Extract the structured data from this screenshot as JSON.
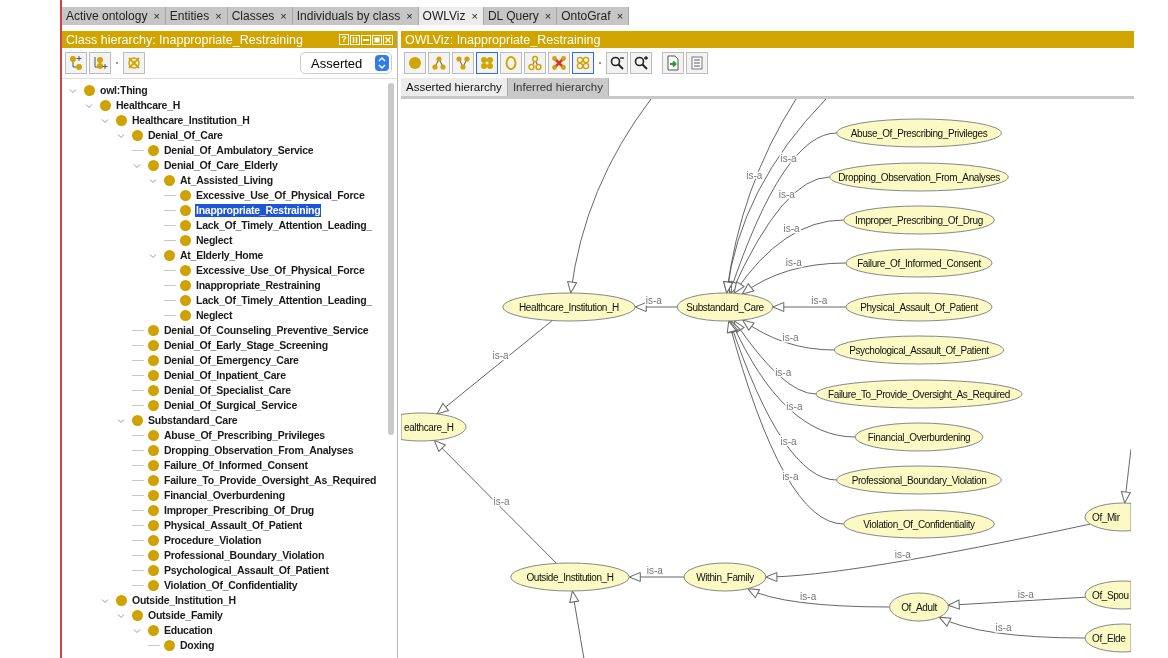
{
  "tabs": [
    {
      "label": "Active ontology",
      "close": "×",
      "selected": false
    },
    {
      "label": "Entities",
      "close": "×",
      "selected": false
    },
    {
      "label": "Classes",
      "close": "×",
      "selected": false
    },
    {
      "label": "Individuals by class",
      "close": "×",
      "selected": false
    },
    {
      "label": "OWLViz",
      "close": "×",
      "selected": true
    },
    {
      "label": "DL Query",
      "close": "×",
      "selected": false
    },
    {
      "label": "OntoGraf",
      "close": "×",
      "selected": false
    }
  ],
  "class_hierarchy": {
    "title": "Class hierarchy: Inappropriate_Restraining",
    "help": "?",
    "mode": "Asserted",
    "tree": [
      {
        "label": "owl:Thing",
        "selected": false,
        "expanded": true,
        "children": [
          {
            "label": "Healthcare_H",
            "selected": false,
            "expanded": true,
            "children": [
              {
                "label": "Healthcare_Institution_H",
                "selected": false,
                "expanded": true,
                "children": [
                  {
                    "label": "Denial_Of_Care",
                    "selected": false,
                    "expanded": true,
                    "children": [
                      {
                        "label": "Denial_Of_Ambulatory_Service",
                        "selected": false
                      },
                      {
                        "label": "Denial_Of_Care_Elderly",
                        "selected": false,
                        "expanded": true,
                        "children": [
                          {
                            "label": "At_Assisted_Living",
                            "selected": false,
                            "expanded": true,
                            "children": [
                              {
                                "label": "Excessive_Use_Of_Physical_Force",
                                "selected": false
                              },
                              {
                                "label": "Inappropriate_Restraining",
                                "selected": true
                              },
                              {
                                "label": "Lack_Of_Timely_Attention_Leading_",
                                "selected": false
                              },
                              {
                                "label": "Neglect",
                                "selected": false
                              }
                            ]
                          },
                          {
                            "label": "At_Elderly_Home",
                            "selected": false,
                            "expanded": true,
                            "children": [
                              {
                                "label": "Excessive_Use_Of_Physical_Force",
                                "selected": false
                              },
                              {
                                "label": "Inappropriate_Restraining",
                                "selected": false
                              },
                              {
                                "label": "Lack_Of_Timely_Attention_Leading_",
                                "selected": false
                              },
                              {
                                "label": "Neglect",
                                "selected": false
                              }
                            ]
                          }
                        ]
                      },
                      {
                        "label": "Denial_Of_Counseling_Preventive_Service",
                        "selected": false
                      },
                      {
                        "label": "Denial_Of_Early_Stage_Screening",
                        "selected": false
                      },
                      {
                        "label": "Denial_Of_Emergency_Care",
                        "selected": false
                      },
                      {
                        "label": "Denial_Of_Inpatient_Care",
                        "selected": false
                      },
                      {
                        "label": "Denial_Of_Specialist_Care",
                        "selected": false
                      },
                      {
                        "label": "Denial_Of_Surgical_Service",
                        "selected": false
                      }
                    ]
                  },
                  {
                    "label": "Substandard_Care",
                    "selected": false,
                    "expanded": true,
                    "children": [
                      {
                        "label": "Abuse_Of_Prescribing_Privileges",
                        "selected": false
                      },
                      {
                        "label": "Dropping_Observation_From_Analyses",
                        "selected": false
                      },
                      {
                        "label": "Failure_Of_Informed_Consent",
                        "selected": false
                      },
                      {
                        "label": "Failure_To_Provide_Oversight_As_Required",
                        "selected": false
                      },
                      {
                        "label": "Financial_Overburdening",
                        "selected": false
                      },
                      {
                        "label": "Improper_Prescribing_Of_Drug",
                        "selected": false
                      },
                      {
                        "label": "Physical_Assault_Of_Patient",
                        "selected": false
                      },
                      {
                        "label": "Procedure_Violation",
                        "selected": false
                      },
                      {
                        "label": "Professional_Boundary_Violation",
                        "selected": false
                      },
                      {
                        "label": "Psychological_Assault_Of_Patient",
                        "selected": false
                      },
                      {
                        "label": "Violation_Of_Confidentiality",
                        "selected": false
                      }
                    ]
                  }
                ]
              },
              {
                "label": "Outside_Institution_H",
                "selected": false,
                "expanded": true,
                "children": [
                  {
                    "label": "Outside_Family",
                    "selected": false,
                    "expanded": true,
                    "children": [
                      {
                        "label": "Education",
                        "selected": false,
                        "expanded": true,
                        "children": [
                          {
                            "label": "Doxing",
                            "selected": false
                          }
                        ]
                      }
                    ]
                  }
                ]
              }
            ]
          }
        ]
      }
    ]
  },
  "owlviz": {
    "title": "OWLViz: Inappropriate_Restraining",
    "toolbar": [
      {
        "on": false
      },
      {
        "on": false
      },
      {
        "on": false
      },
      {
        "on": true
      },
      {
        "on": false
      },
      {
        "on": false
      },
      {
        "on": false
      },
      {
        "on": true
      },
      {
        "on": false
      },
      {
        "on": false
      },
      {
        "on": false
      },
      {
        "on": false
      }
    ],
    "view_tabs": [
      {
        "label": "Asserted hierarchy",
        "selected": true
      },
      {
        "label": "Inferred hierarchy",
        "selected": false
      }
    ],
    "graph": {
      "nodes": [
        {
          "label": "Healthcare_Institution_H"
        },
        {
          "label": "Substandard_Care"
        },
        {
          "label": "ealthcare_H"
        },
        {
          "label": "Outside_Institution_H"
        },
        {
          "label": "Within_Family"
        },
        {
          "label": "Abuse_Of_Prescribing_Privileges"
        },
        {
          "label": "Dropping_Observation_From_Analyses"
        },
        {
          "label": "Improper_Prescribing_Of_Drug"
        },
        {
          "label": "Failure_Of_Informed_Consent"
        },
        {
          "label": "Physical_Assault_Of_Patient"
        },
        {
          "label": "Psychological_Assault_Of_Patient"
        },
        {
          "label": "Failure_To_Provide_Oversight_As_Required"
        },
        {
          "label": "Financial_Overburdening"
        },
        {
          "label": "Professional_Boundary_Violation"
        },
        {
          "label": "Violation_Of_Confidentiality"
        },
        {
          "label": "Of_Adult"
        },
        {
          "label": "Of_Mir"
        },
        {
          "label": "Of_Spou"
        },
        {
          "label": "Of_Elde"
        }
      ],
      "edges": [
        {
          "label": "is-a"
        },
        {
          "label": "is-a"
        },
        {
          "label": "is-a"
        },
        {
          "label": "is-a"
        },
        {
          "label": "is-a"
        },
        {
          "label": "is-a"
        },
        {
          "label": "is-a"
        },
        {
          "label": "is-a"
        },
        {
          "label": "is-a"
        },
        {
          "label": "is-a"
        },
        {
          "label": "is-a"
        },
        {
          "label": "is-a"
        },
        {
          "label": "is-a"
        },
        {
          "label": "is-a"
        },
        {
          "label": "is-a"
        },
        {
          "label": "is-a"
        },
        {
          "label": "is-a"
        },
        {
          "label": "is-a"
        },
        {
          "label": "is-a"
        }
      ]
    }
  }
}
